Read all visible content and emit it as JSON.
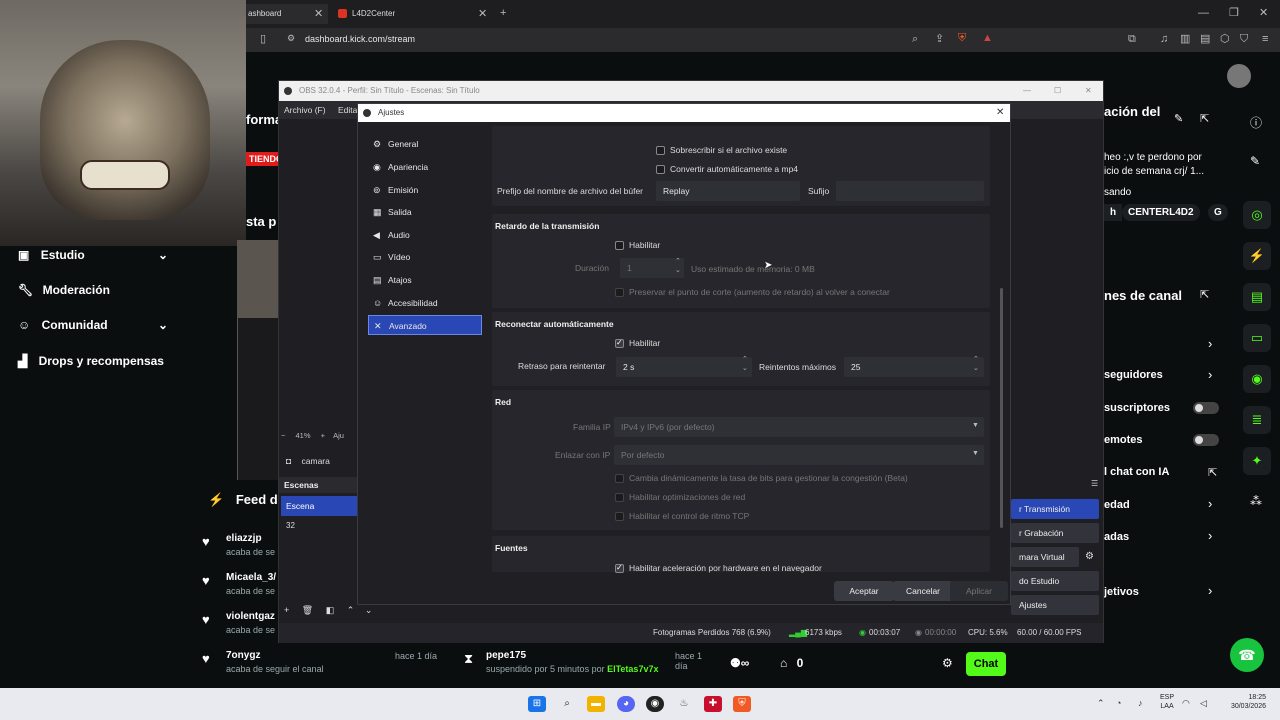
{
  "browser": {
    "tab1": "ashboard",
    "tab2": "L4D2Center",
    "url": "dashboard.kick.com/stream"
  },
  "kick": {
    "overlay_partial_1": "forma",
    "overlay_partial_2": "TIENDO",
    "overlay_partial_3": "sta p",
    "nav": {
      "studio": "Estudio",
      "moderation": "Moderación",
      "community": "Comunidad",
      "drops": "Drops y recompensas"
    },
    "feed": {
      "title": "Feed de",
      "items": [
        {
          "name": "eliazzjp",
          "sub": "acaba de se"
        },
        {
          "name": "Micaela_3/",
          "sub": "acaba de se"
        },
        {
          "name": "violentgaz",
          "sub": "acaba de se"
        },
        {
          "name": "7onygz",
          "sub": "acaba de seguir el canal",
          "time": "hace 1 día"
        }
      ],
      "suspension": {
        "name": "pepe175",
        "text": "suspendido por 5 minutos por",
        "by": "ElTetas7v7x",
        "time": "hace 1 día"
      }
    },
    "right": {
      "title1": "ación del",
      "text1": "heo :,v te perdono por",
      "text2": "icio de semana crj/ 1...",
      "text3": "sando",
      "tag1": "h",
      "tag2": "CENTERL4D2",
      "tag3": "G",
      "section": "nes de canal",
      "rows": [
        "seguidores",
        "suscriptores",
        "emotes",
        "l chat con IA",
        "edad",
        "adas",
        "jetivos"
      ]
    },
    "bottom": {
      "viewers": "0",
      "followers": "0",
      "chat_button": "Chat"
    }
  },
  "obs": {
    "title": "OBS 32.0.4 - Perfil: Sin Título - Escenas: Sin Título",
    "menu": [
      "Archivo (F)",
      "Editar"
    ],
    "zoom": "41%",
    "preview_btn": "Aju",
    "source": "camara",
    "scenes_header": "Escenas",
    "scene": "Escena",
    "scene_extra": "32",
    "controls": [
      "r Transmisión",
      "r Grabación",
      "mara Virtual",
      "do Estudio",
      "Ajustes"
    ],
    "status": {
      "dropped": "Fotogramas Perdidos 768 (6.9%)",
      "bitrate": "6173 kbps",
      "live_time": "00:03:07",
      "rec_time": "00:00:00",
      "cpu": "CPU: 5.6%",
      "fps": "60.00 / 60.00 FPS"
    }
  },
  "settings": {
    "title": "Ajustes",
    "categories": [
      "General",
      "Apariencia",
      "Emisión",
      "Salida",
      "Audio",
      "Vídeo",
      "Atajos",
      "Accesibilidad",
      "Avanzado"
    ],
    "top": {
      "overwrite": "Sobrescribir si el archivo existe",
      "convert_mp4": "Convertir automáticamente a mp4",
      "prefix_label": "Prefijo del nombre de archivo del búfer",
      "prefix_value": "Replay",
      "suffix_label": "Sufijo",
      "suffix_value": ""
    },
    "delay": {
      "title": "Retardo de la transmisión",
      "enable": "Habilitar",
      "duration_label": "Duración",
      "duration_value": "1",
      "memory": "Uso estimado de memoria: 0 MB",
      "preserve": "Preservar el punto de corte (aumento de retardo) al volver a conectar"
    },
    "reconnect": {
      "title": "Reconectar automáticamente",
      "enable": "Habilitar",
      "retry_label": "Retraso para reintentar",
      "retry_value": "2 s",
      "max_label": "Reintentos máximos",
      "max_value": "25"
    },
    "network": {
      "title": "Red",
      "ip_family_label": "Familia IP",
      "ip_family_value": "IPv4 y IPv6 (por defecto)",
      "bind_label": "Enlazar con IP",
      "bind_value": "Por defecto",
      "opt1": "Cambia dinámicamente la tasa de bits para gestionar la congestión (Beta)",
      "opt2": "Habilitar optimizaciones de red",
      "opt3": "Habilitar el control de ritmo TCP"
    },
    "sources": {
      "title": "Fuentes",
      "hw_accel": "Habilitar aceleración por hardware en el navegador"
    },
    "buttons": {
      "accept": "Aceptar",
      "cancel": "Cancelar",
      "apply": "Aplicar"
    }
  },
  "taskbar": {
    "lang": "ESP",
    "lang2": "LAA",
    "time": "18:25",
    "date": "30/03/2026"
  }
}
